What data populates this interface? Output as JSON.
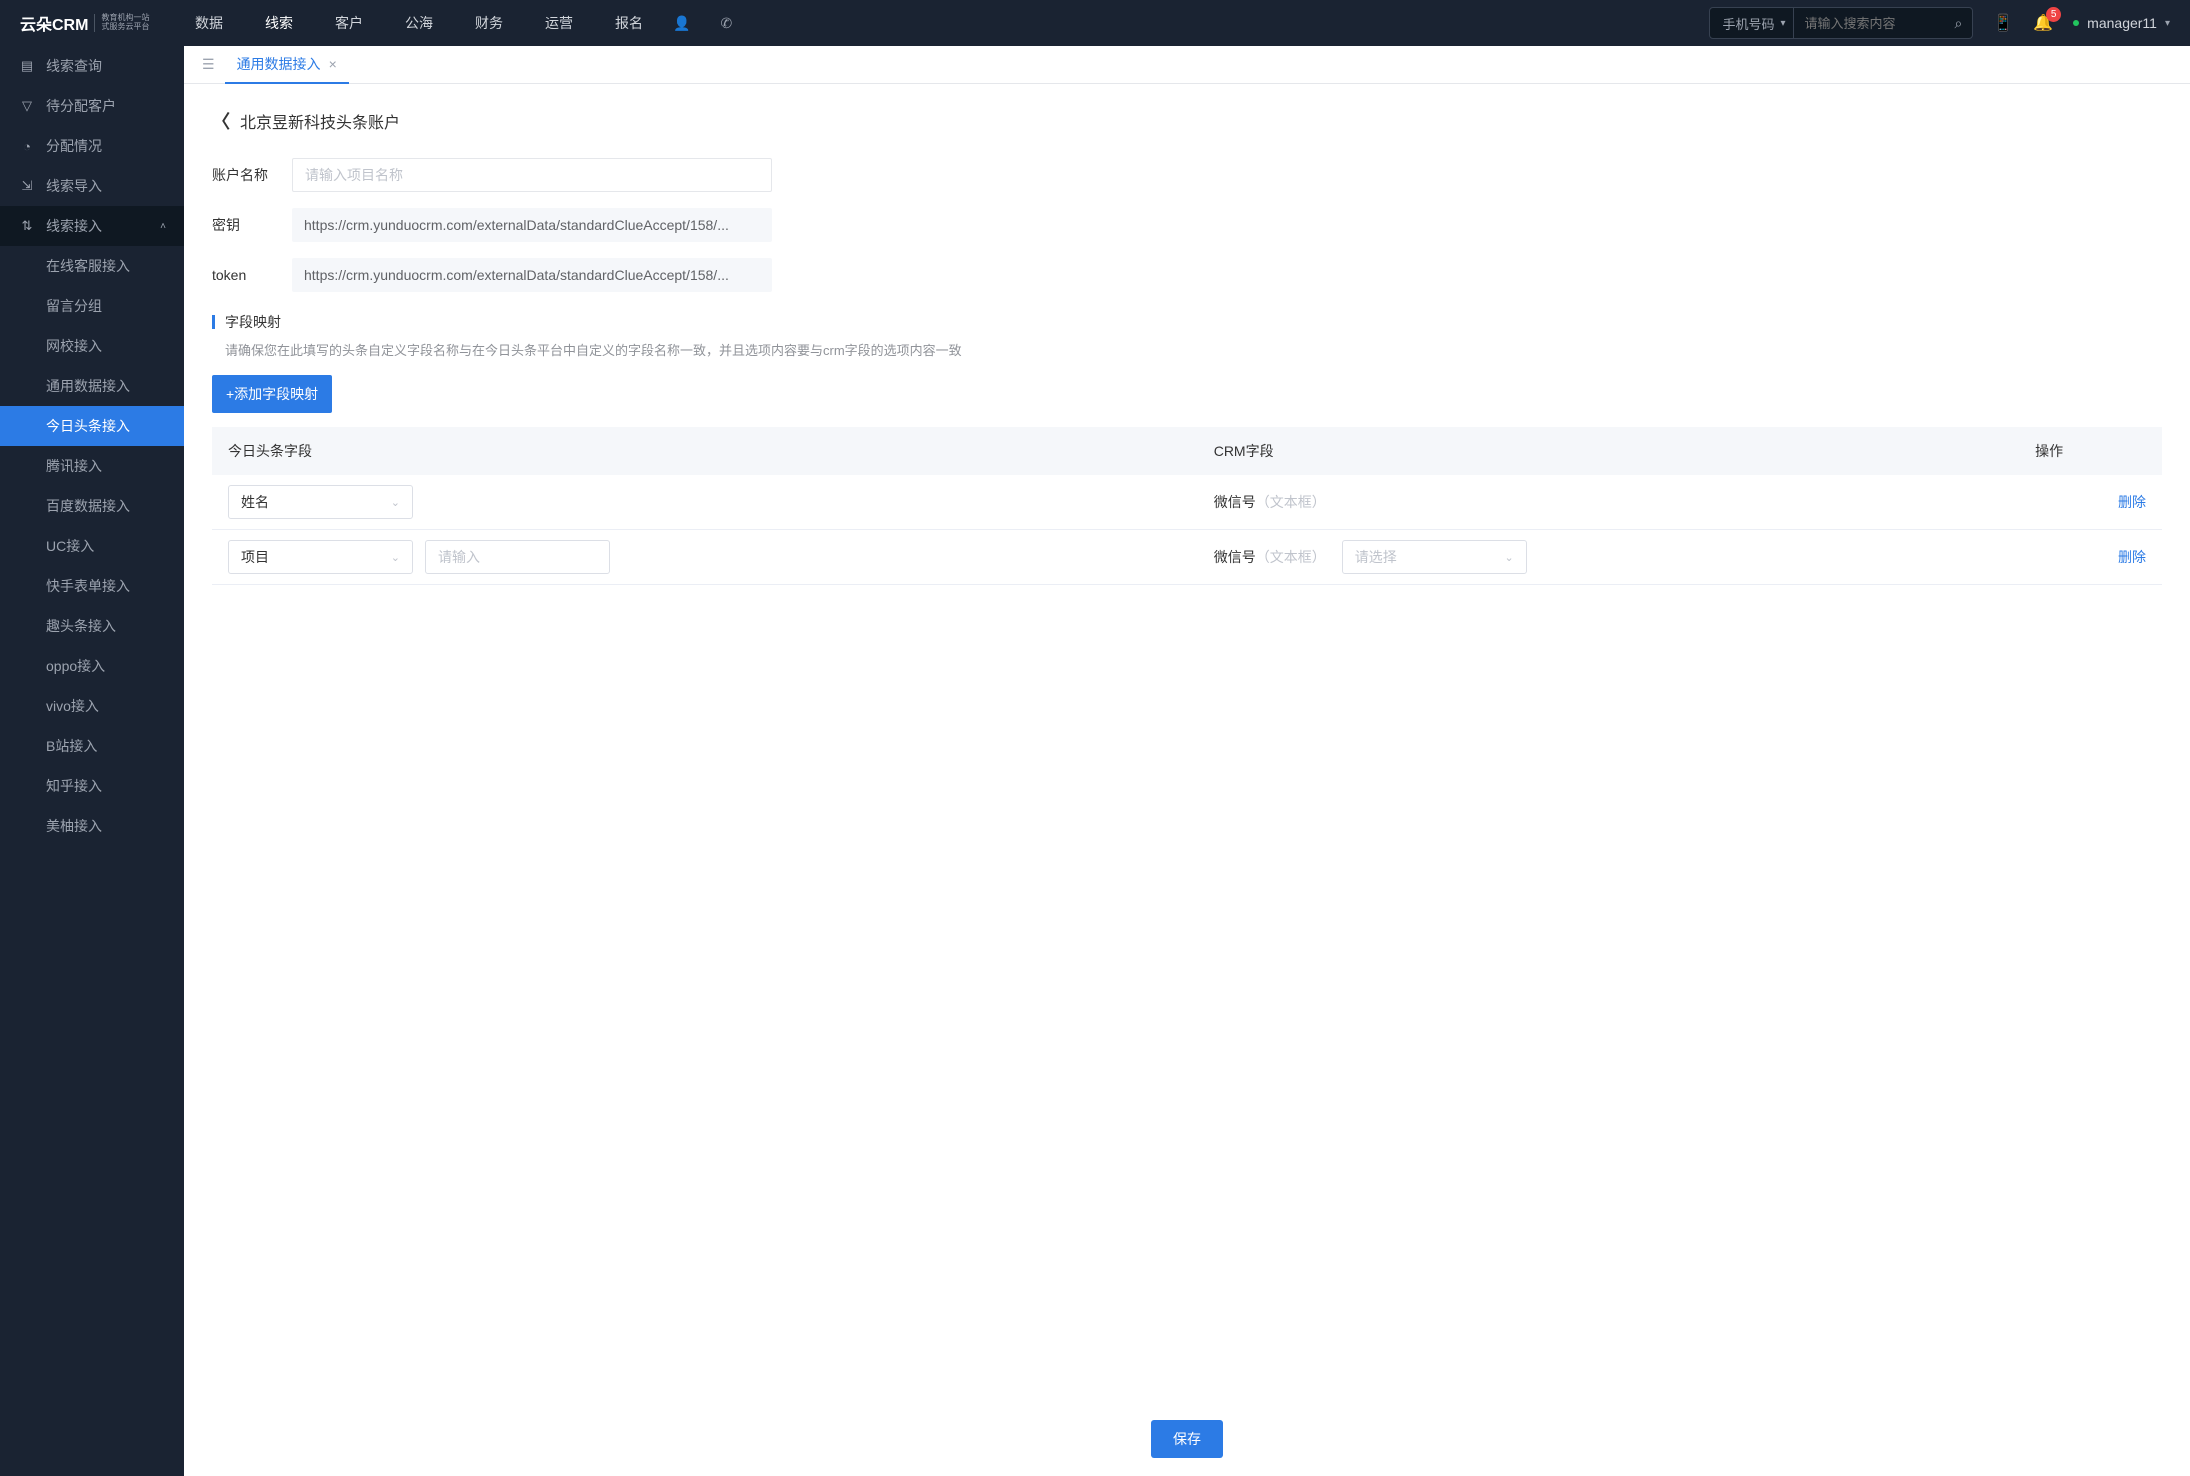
{
  "header": {
    "logo": {
      "main": "云朵CRM",
      "sub1": "教育机构一站",
      "sub2": "式服务云平台"
    },
    "nav": [
      "数据",
      "线索",
      "客户",
      "公海",
      "财务",
      "运营",
      "报名"
    ],
    "activeNavIndex": 1,
    "search": {
      "category": "手机号码",
      "placeholder": "请输入搜索内容"
    },
    "badge": "5",
    "user": "manager11"
  },
  "sidebar": {
    "top": [
      {
        "icon": "▤",
        "label": "线索查询"
      },
      {
        "icon": "▽",
        "label": "待分配客户"
      },
      {
        "icon": "◔",
        "label": "分配情况"
      },
      {
        "icon": "⇲",
        "label": "线索导入"
      }
    ],
    "expandable": {
      "icon": "⇅",
      "label": "线索接入"
    },
    "subs": [
      "在线客服接入",
      "留言分组",
      "网校接入",
      "通用数据接入",
      "今日头条接入",
      "腾讯接入",
      "百度数据接入",
      "UC接入",
      "快手表单接入",
      "趣头条接入",
      "oppo接入",
      "vivo接入",
      "B站接入",
      "知乎接入",
      "美柚接入"
    ],
    "activeSubIndex": 4
  },
  "tabs": {
    "active": "通用数据接入"
  },
  "page": {
    "title": "北京昱新科技头条账户",
    "form": {
      "accountLabel": "账户名称",
      "accountPlaceholder": "请输入项目名称",
      "secretLabel": "密钥",
      "secretValue": "https://crm.yunduocrm.com/externalData/standardClueAccept/158/...",
      "tokenLabel": "token",
      "tokenValue": "https://crm.yunduocrm.com/externalData/standardClueAccept/158/..."
    },
    "section": {
      "title": "字段映射",
      "desc": "请确保您在此填写的头条自定义字段名称与在今日头条平台中自定义的字段名称一致，并且选项内容要与crm字段的选项内容一致"
    },
    "addBtn": "+添加字段映射",
    "table": {
      "headers": {
        "toutiao": "今日头条字段",
        "crm": "CRM字段",
        "action": "操作"
      },
      "rows": [
        {
          "toutiaoValue": "姓名",
          "extraInput": false,
          "crmLabel": "微信号",
          "crmType": "（文本框）",
          "crmSelect": false,
          "deleteLabel": "删除"
        },
        {
          "toutiaoValue": "项目",
          "extraInput": true,
          "extraPlaceholder": "请输入",
          "crmLabel": "微信号",
          "crmType": "（文本框）",
          "crmSelect": true,
          "crmSelectPlaceholder": "请选择",
          "deleteLabel": "删除"
        }
      ]
    },
    "saveBtn": "保存"
  }
}
